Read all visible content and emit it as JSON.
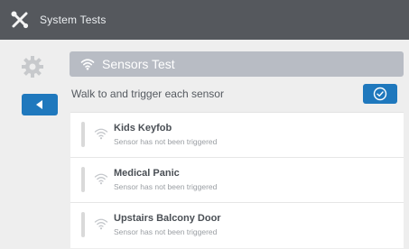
{
  "topbar": {
    "title": "System Tests",
    "icon": "tools-icon"
  },
  "sidebar": {
    "settings_icon": "gear-icon",
    "back_icon": "triangle-left-icon",
    "accent_color": "#1f78bd"
  },
  "header": {
    "icon": "wifi-icon",
    "title": "Sensors Test"
  },
  "instruction": "Walk to and trigger each sensor",
  "confirm_icon": "check-circle-icon",
  "sensors": [
    {
      "name": "Kids Keyfob",
      "status": "Sensor has not been triggered",
      "icon": "wifi-icon"
    },
    {
      "name": "Medical Panic",
      "status": "Sensor has not been triggered",
      "icon": "wifi-icon"
    },
    {
      "name": "Upstairs Balcony Door",
      "status": "Sensor has not been triggered",
      "icon": "wifi-icon"
    }
  ]
}
